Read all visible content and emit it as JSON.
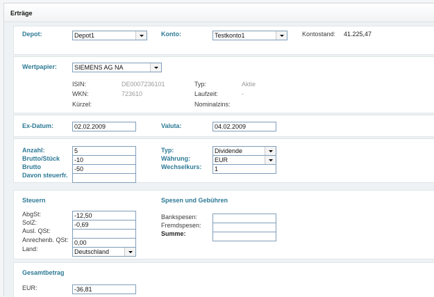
{
  "header": {
    "title": "Erträge"
  },
  "depot_section": {
    "depot_label": "Depot:",
    "depot_value": "Depot1",
    "konto_label": "Konto:",
    "konto_value": "Testkonto1",
    "kontostand_label": "Kontostand:",
    "kontostand_value": "41.225,47"
  },
  "wertpapier_section": {
    "label": "Wertpapier:",
    "value": "SIEMENS AG NA",
    "isin_label": "ISIN:",
    "isin_value": "DE0007236101",
    "wkn_label": "WKN:",
    "wkn_value": "723610",
    "kuerzel_label": "Kürzel:",
    "typ_label": "Typ:",
    "typ_value": "Aktie",
    "laufzeit_label": "Laufzeit:",
    "laufzeit_value": "-",
    "nominalzins_label": "Nominalzins:"
  },
  "dates_section": {
    "exdatum_label": "Ex-Datum:",
    "exdatum_value": "02.02.2009",
    "valuta_label": "Valuta:",
    "valuta_value": "04.02.2009"
  },
  "amounts_section": {
    "anzahl_label": "Anzahl:",
    "anzahl_value": "5",
    "brutto_stueck_label": "Brutto/Stück",
    "brutto_stueck_value": "-10",
    "brutto_label": "Brutto",
    "brutto_value": "-50",
    "davon_label": "Davon steuerfr.",
    "davon_value": "",
    "typ_label": "Typ:",
    "typ_value": "Dividende",
    "waehrung_label": "Währung:",
    "waehrung_value": "EUR",
    "wechselkurs_label": "Wechselkurs:",
    "wechselkurs_value": "1"
  },
  "steuern_section": {
    "title": "Steuern",
    "abgst_label": "AbgSt:",
    "abgst_value": "-12,50",
    "solz_label": "SolZ:",
    "solz_value": "-0,69",
    "auslqst_label": "Ausl. QSt:",
    "auslqst_value": "",
    "anrechenb_label": "Anrechenb. QSt:",
    "anrechenb_value": "0,00",
    "land_label": "Land:",
    "land_value": "Deutschland",
    "spesen_title": "Spesen und Gebühren",
    "bankspesen_label": "Bankspesen:",
    "bankspesen_value": "",
    "fremdspesen_label": "Fremdspesen:",
    "fremdspesen_value": "",
    "summe_label": "Summe:",
    "summe_value": ""
  },
  "gesamt_section": {
    "title": "Gesamtbetrag",
    "eur_label": "EUR:",
    "eur_value": "-36,81"
  },
  "icons": {
    "dropdown": "chevron-down-icon"
  },
  "colors": {
    "label_blue": "#2d7a95",
    "input_border": "#7f9db9",
    "background": "#eef2f4"
  }
}
